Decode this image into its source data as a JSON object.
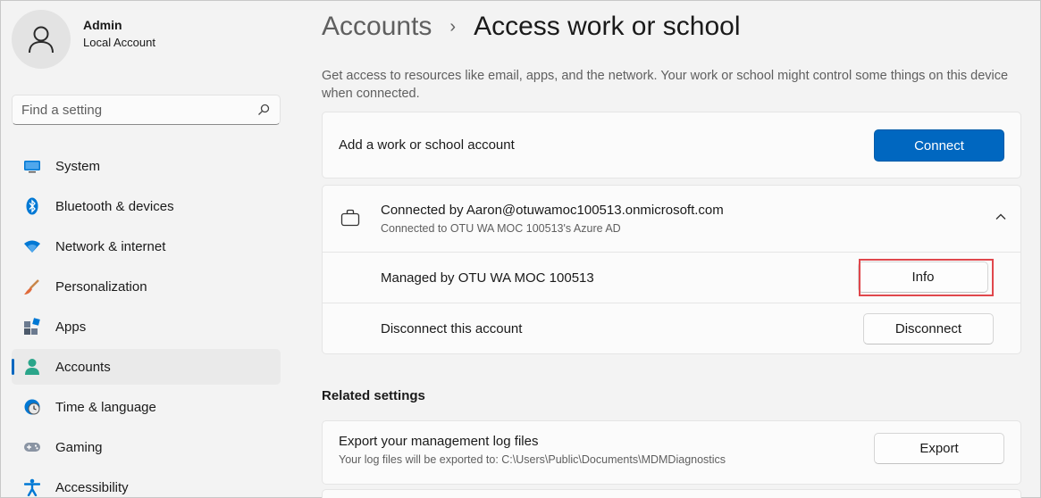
{
  "profile": {
    "name": "Admin",
    "account_type": "Local Account"
  },
  "search": {
    "placeholder": "Find a setting"
  },
  "sidebar": {
    "items": [
      {
        "label": "System",
        "icon": "system-icon",
        "active": false
      },
      {
        "label": "Bluetooth & devices",
        "icon": "bluetooth-icon",
        "active": false
      },
      {
        "label": "Network & internet",
        "icon": "network-icon",
        "active": false
      },
      {
        "label": "Personalization",
        "icon": "brush-icon",
        "active": false
      },
      {
        "label": "Apps",
        "icon": "apps-icon",
        "active": false
      },
      {
        "label": "Accounts",
        "icon": "accounts-icon",
        "active": true
      },
      {
        "label": "Time & language",
        "icon": "clock-globe-icon",
        "active": false
      },
      {
        "label": "Gaming",
        "icon": "gamepad-icon",
        "active": false
      },
      {
        "label": "Accessibility",
        "icon": "accessibility-icon",
        "active": false
      }
    ]
  },
  "breadcrumb": {
    "parent": "Accounts",
    "separator": "›",
    "current": "Access work or school"
  },
  "description": "Get access to resources like email, apps, and the network. Your work or school might control some things on this device when connected.",
  "add_account": {
    "label": "Add a work or school account",
    "button": "Connect"
  },
  "connected_account": {
    "title": "Connected by Aaron@otuwamoc100513.onmicrosoft.com",
    "subtitle": "Connected to OTU WA MOC 100513's Azure AD",
    "managed_label": "Managed by OTU WA MOC 100513",
    "info_button": "Info",
    "disconnect_label": "Disconnect this account",
    "disconnect_button": "Disconnect"
  },
  "related_settings": {
    "title": "Related settings",
    "export": {
      "title": "Export your management log files",
      "subtitle": "Your log files will be exported to: C:\\Users\\Public\\Documents\\MDMDiagnostics",
      "button": "Export"
    }
  },
  "colors": {
    "accent": "#0067c0",
    "highlight": "#e0474c",
    "background": "#f3f3f3"
  }
}
